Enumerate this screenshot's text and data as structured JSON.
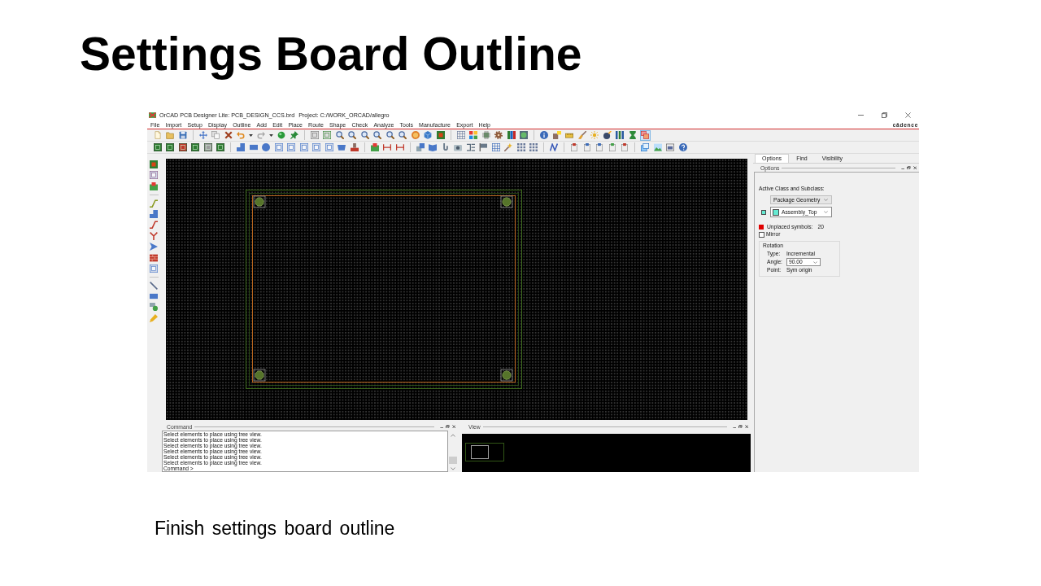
{
  "slide": {
    "title": "Settings Board Outline",
    "caption": "Finish settings board outline"
  },
  "window": {
    "title": "OrCAD PCB Designer Lite: PCB_DESIGN_CCS.brd",
    "project": "Project: C:/WORK_ORCAD/allegro",
    "brand": "cādence"
  },
  "menu": [
    "File",
    "Import",
    "Setup",
    "Display",
    "Outline",
    "Add",
    "Edit",
    "Place",
    "Route",
    "Shape",
    "Check",
    "Analyze",
    "Tools",
    "Manufacture",
    "Export",
    "Help"
  ],
  "toolbars": {
    "top": [
      {
        "selected": false
      },
      {
        "selected": false
      },
      {
        "selected": false
      },
      {
        "selected": false
      },
      {
        "selected": false
      },
      {
        "selected": false
      },
      {
        "selected": false
      },
      {
        "selected": false
      },
      {
        "selected": false
      },
      {
        "selected": false
      },
      {
        "selected": false
      },
      {
        "selected": false
      },
      {
        "selected": false
      },
      {
        "selected": false
      },
      {
        "selected": false
      },
      {
        "selected": false
      },
      {
        "selected": false
      },
      {
        "selected": false
      },
      {
        "selected": false
      },
      {
        "selected": false
      },
      {
        "selected": false
      },
      {
        "selected": false
      },
      {
        "selected": false
      },
      {
        "selected": false
      },
      {
        "selected": false
      },
      {
        "selected": false
      },
      {
        "selected": false
      },
      {
        "selected": false
      },
      {
        "selected": false
      },
      {
        "selected": false
      },
      {
        "selected": false
      },
      {
        "selected": false
      },
      {
        "selected": false
      },
      {
        "selected": false
      },
      {
        "selected": false
      },
      {
        "selected": false
      },
      {
        "selected": false
      },
      {
        "selected": true
      }
    ],
    "second": [
      {
        "selected": false
      },
      {
        "selected": false
      },
      {
        "selected": false
      },
      {
        "selected": false
      },
      {
        "selected": false
      },
      {
        "selected": false
      },
      {
        "selected": false
      },
      {
        "selected": false
      },
      {
        "selected": false
      },
      {
        "selected": false
      },
      {
        "selected": false
      },
      {
        "selected": false
      },
      {
        "selected": false
      },
      {
        "selected": false
      },
      {
        "selected": false
      },
      {
        "selected": false
      },
      {
        "selected": false
      },
      {
        "selected": false
      },
      {
        "selected": false
      },
      {
        "selected": false
      },
      {
        "selected": false
      },
      {
        "selected": false
      },
      {
        "selected": false
      },
      {
        "selected": false
      },
      {
        "selected": false
      },
      {
        "selected": false
      },
      {
        "selected": false
      },
      {
        "selected": false
      },
      {
        "selected": false
      },
      {
        "selected": false
      },
      {
        "selected": false
      },
      {
        "selected": false
      },
      {
        "selected": false
      },
      {
        "selected": false
      },
      {
        "selected": false
      },
      {
        "selected": false
      },
      {
        "selected": false
      },
      {
        "selected": false
      },
      {
        "selected": false
      }
    ],
    "left": [
      {
        "selected": false
      },
      {
        "selected": false
      },
      {
        "selected": false
      },
      {
        "selected": false
      },
      {
        "selected": false
      },
      {
        "selected": false
      },
      {
        "selected": false
      },
      {
        "selected": false
      },
      {
        "selected": false
      },
      {
        "selected": false
      },
      {
        "selected": false
      },
      {
        "selected": false
      },
      {
        "selected": false
      },
      {
        "selected": false
      }
    ]
  },
  "options_panel": {
    "tabs": [
      {
        "label": "Options",
        "selected": true
      },
      {
        "label": "Find",
        "selected": false
      },
      {
        "label": "Visibility",
        "selected": false
      }
    ],
    "title": "Options",
    "class_label": "Active Class and Subclass:",
    "class_value": "Package Geometry",
    "subclass_value": "Assembly_Top",
    "unplaced_label": "Unplaced symbols:",
    "unplaced_count": "20",
    "mirror": {
      "label": "Mirror",
      "checked": false
    },
    "rotation": {
      "title": "Rotation",
      "rows": [
        {
          "kind": "text",
          "label": "Type:",
          "value": "Incremental"
        },
        {
          "kind": "dropdown",
          "label": "Angle:",
          "value": "90.00"
        },
        {
          "kind": "text",
          "label": "Point:",
          "value": "Sym origin"
        }
      ]
    }
  },
  "command_panel": {
    "title": "Command",
    "lines": [
      "Select elements to place using tree view.",
      "Select elements to place using tree view.",
      "Select elements to place using tree view.",
      "Select elements to place using tree view.",
      "Select elements to place using tree view.",
      "Select elements to place using tree view."
    ],
    "prompt": "Command >"
  },
  "view_panel": {
    "title": "View"
  }
}
